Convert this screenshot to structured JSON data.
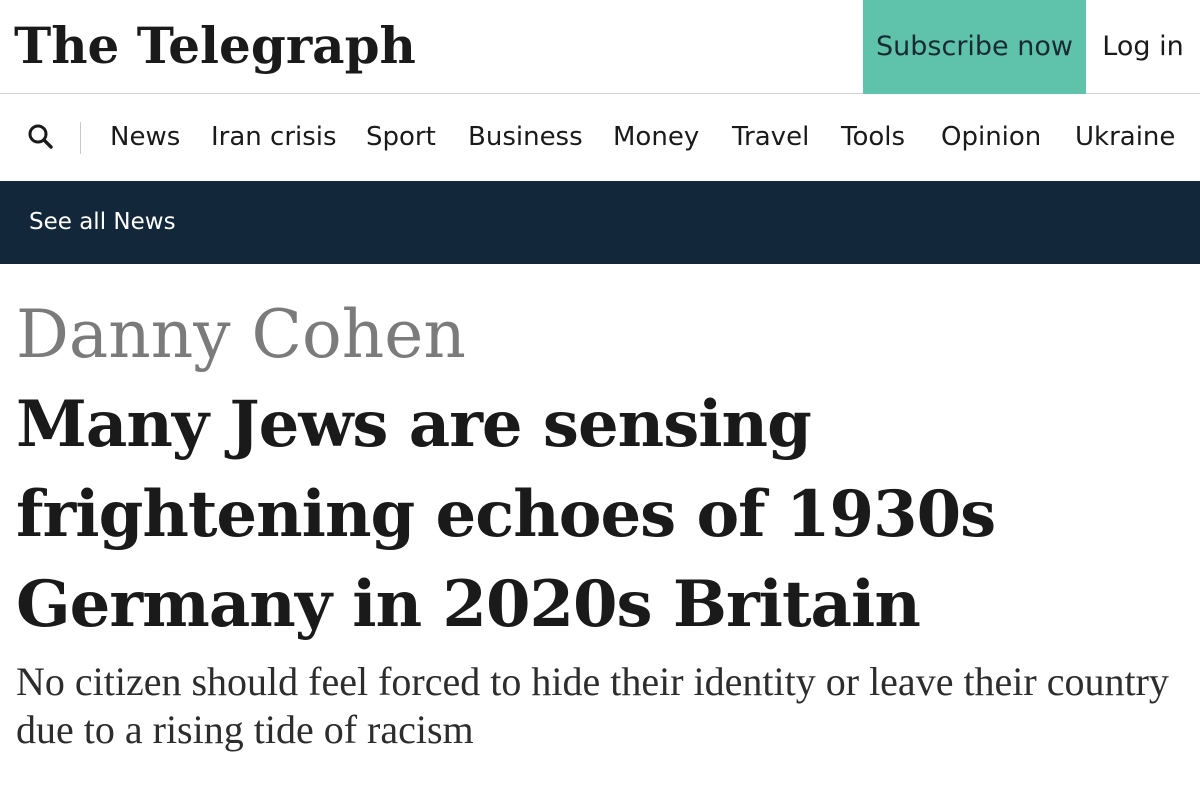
{
  "header": {
    "masthead": "The Telegraph",
    "subscribe_label": "Subscribe now",
    "login_label": "Log in",
    "subscribe_color": "#5fc3ac"
  },
  "nav": {
    "search_icon": "search-icon",
    "items": [
      {
        "label": "News"
      },
      {
        "label": "Iran crisis"
      },
      {
        "label": "Sport"
      },
      {
        "label": "Business"
      },
      {
        "label": "Money"
      },
      {
        "label": "Travel"
      },
      {
        "label": "Tools"
      },
      {
        "label": "Opinion"
      },
      {
        "label": "Ukraine"
      }
    ]
  },
  "subnav": {
    "see_all_label": "See all News",
    "background_color": "#12273a"
  },
  "article": {
    "author": "Danny Cohen",
    "headline": "Many Jews are sensing frightening echoes of 1930s Germany in 2020s Britain",
    "standfirst": "No citizen should feel forced to hide their identity or leave their country due to a rising tide of racism"
  }
}
